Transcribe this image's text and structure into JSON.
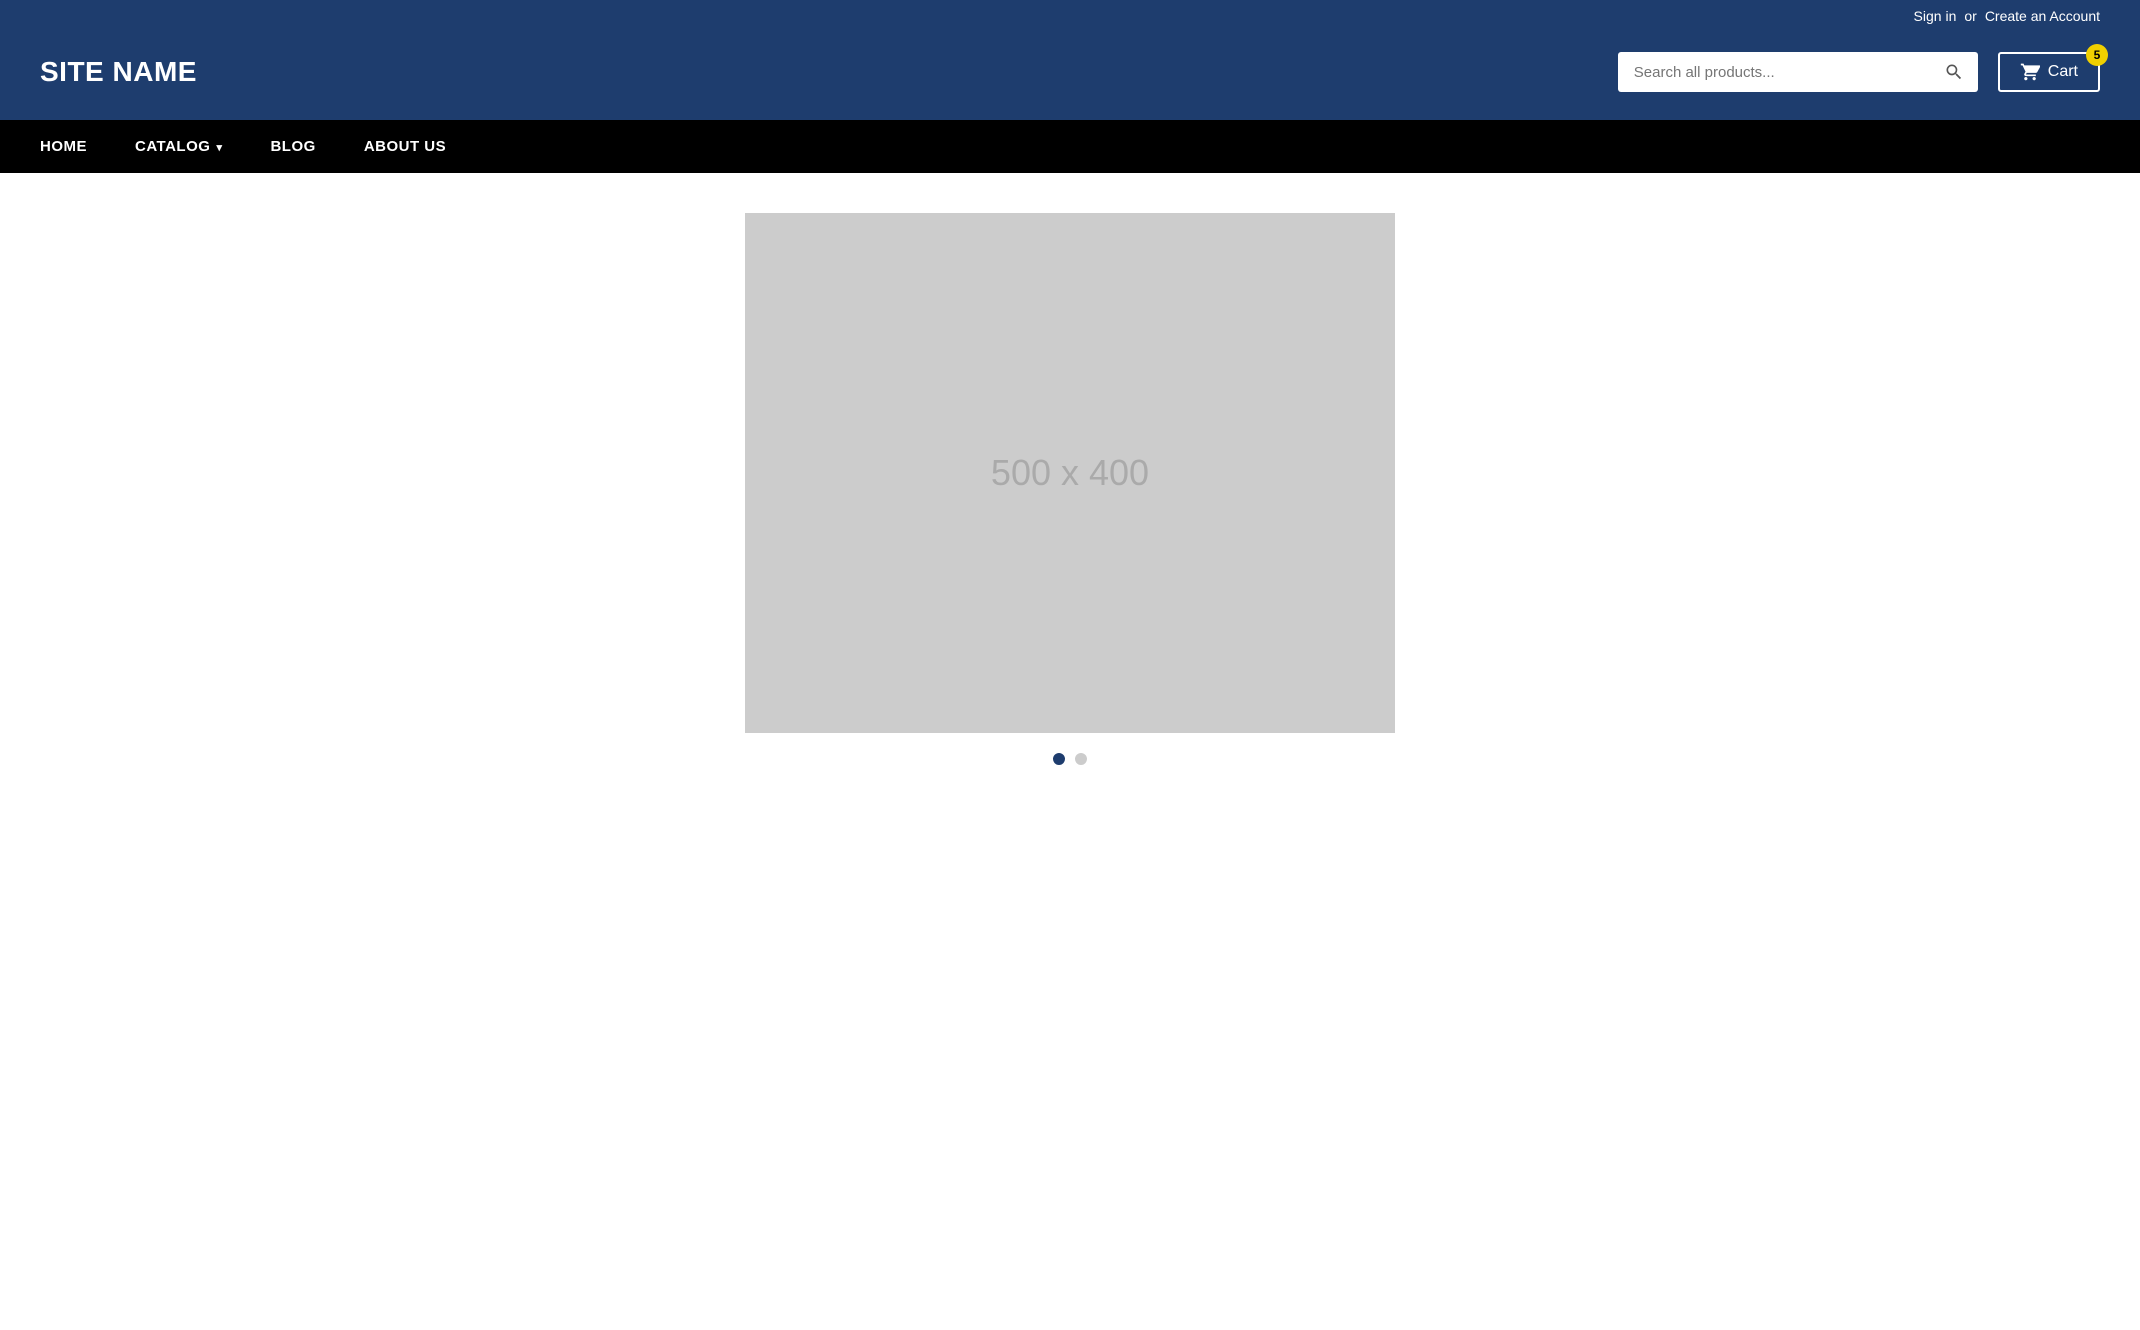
{
  "topbar": {
    "signin_label": "Sign in",
    "separator": "or",
    "create_account_label": "Create an Account"
  },
  "header": {
    "site_name": "SITE NAME",
    "search_placeholder": "Search all products...",
    "cart_label": "Cart",
    "cart_count": "5"
  },
  "nav": {
    "items": [
      {
        "label": "HOME",
        "has_dropdown": false
      },
      {
        "label": "CATALOG",
        "has_dropdown": true
      },
      {
        "label": "BLOG",
        "has_dropdown": false
      },
      {
        "label": "ABOUT US",
        "has_dropdown": false
      }
    ]
  },
  "main": {
    "placeholder_text": "500 x 400",
    "dots": [
      {
        "active": true
      },
      {
        "active": false
      }
    ]
  }
}
